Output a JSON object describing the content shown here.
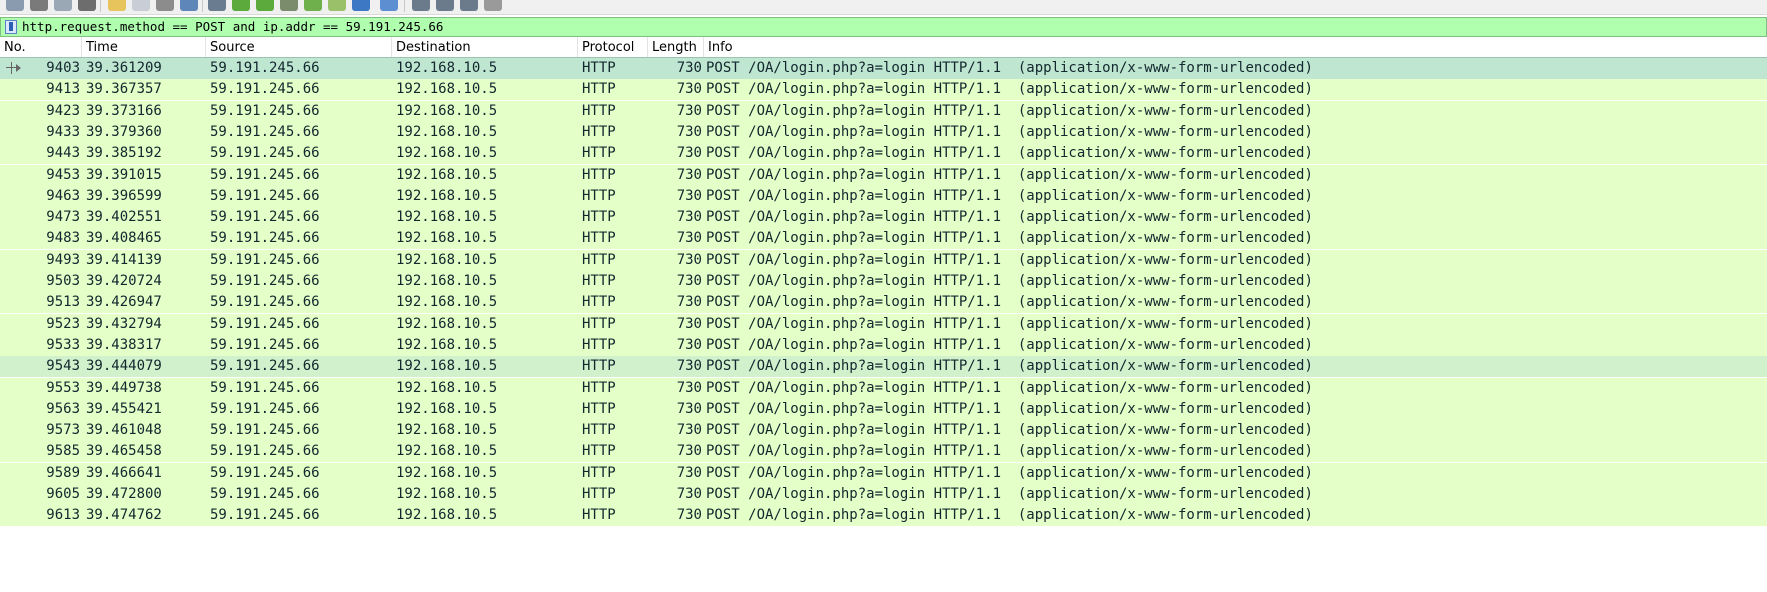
{
  "filter": {
    "expression": "http.request.method == POST and ip.addr == 59.191.245.66"
  },
  "columns": [
    "No.",
    "Time",
    "Source",
    "Destination",
    "Protocol",
    "Length",
    "Info"
  ],
  "packets": [
    {
      "no": "9403",
      "time": "39.361209",
      "src": "59.191.245.66",
      "dst": "192.168.10.5",
      "proto": "HTTP",
      "len": "730",
      "info": "POST /OA/login.php?a=login HTTP/1.1  (application/x-www-form-urlencoded)"
    },
    {
      "no": "9413",
      "time": "39.367357",
      "src": "59.191.245.66",
      "dst": "192.168.10.5",
      "proto": "HTTP",
      "len": "730",
      "info": "POST /OA/login.php?a=login HTTP/1.1  (application/x-www-form-urlencoded)"
    },
    {
      "no": "9423",
      "time": "39.373166",
      "src": "59.191.245.66",
      "dst": "192.168.10.5",
      "proto": "HTTP",
      "len": "730",
      "info": "POST /OA/login.php?a=login HTTP/1.1  (application/x-www-form-urlencoded)"
    },
    {
      "no": "9433",
      "time": "39.379360",
      "src": "59.191.245.66",
      "dst": "192.168.10.5",
      "proto": "HTTP",
      "len": "730",
      "info": "POST /OA/login.php?a=login HTTP/1.1  (application/x-www-form-urlencoded)"
    },
    {
      "no": "9443",
      "time": "39.385192",
      "src": "59.191.245.66",
      "dst": "192.168.10.5",
      "proto": "HTTP",
      "len": "730",
      "info": "POST /OA/login.php?a=login HTTP/1.1  (application/x-www-form-urlencoded)"
    },
    {
      "no": "9453",
      "time": "39.391015",
      "src": "59.191.245.66",
      "dst": "192.168.10.5",
      "proto": "HTTP",
      "len": "730",
      "info": "POST /OA/login.php?a=login HTTP/1.1  (application/x-www-form-urlencoded)"
    },
    {
      "no": "9463",
      "time": "39.396599",
      "src": "59.191.245.66",
      "dst": "192.168.10.5",
      "proto": "HTTP",
      "len": "730",
      "info": "POST /OA/login.php?a=login HTTP/1.1  (application/x-www-form-urlencoded)"
    },
    {
      "no": "9473",
      "time": "39.402551",
      "src": "59.191.245.66",
      "dst": "192.168.10.5",
      "proto": "HTTP",
      "len": "730",
      "info": "POST /OA/login.php?a=login HTTP/1.1  (application/x-www-form-urlencoded)"
    },
    {
      "no": "9483",
      "time": "39.408465",
      "src": "59.191.245.66",
      "dst": "192.168.10.5",
      "proto": "HTTP",
      "len": "730",
      "info": "POST /OA/login.php?a=login HTTP/1.1  (application/x-www-form-urlencoded)"
    },
    {
      "no": "9493",
      "time": "39.414139",
      "src": "59.191.245.66",
      "dst": "192.168.10.5",
      "proto": "HTTP",
      "len": "730",
      "info": "POST /OA/login.php?a=login HTTP/1.1  (application/x-www-form-urlencoded)"
    },
    {
      "no": "9503",
      "time": "39.420724",
      "src": "59.191.245.66",
      "dst": "192.168.10.5",
      "proto": "HTTP",
      "len": "730",
      "info": "POST /OA/login.php?a=login HTTP/1.1  (application/x-www-form-urlencoded)"
    },
    {
      "no": "9513",
      "time": "39.426947",
      "src": "59.191.245.66",
      "dst": "192.168.10.5",
      "proto": "HTTP",
      "len": "730",
      "info": "POST /OA/login.php?a=login HTTP/1.1  (application/x-www-form-urlencoded)"
    },
    {
      "no": "9523",
      "time": "39.432794",
      "src": "59.191.245.66",
      "dst": "192.168.10.5",
      "proto": "HTTP",
      "len": "730",
      "info": "POST /OA/login.php?a=login HTTP/1.1  (application/x-www-form-urlencoded)"
    },
    {
      "no": "9533",
      "time": "39.438317",
      "src": "59.191.245.66",
      "dst": "192.168.10.5",
      "proto": "HTTP",
      "len": "730",
      "info": "POST /OA/login.php?a=login HTTP/1.1  (application/x-www-form-urlencoded)"
    },
    {
      "no": "9543",
      "time": "39.444079",
      "src": "59.191.245.66",
      "dst": "192.168.10.5",
      "proto": "HTTP",
      "len": "730",
      "info": "POST /OA/login.php?a=login HTTP/1.1  (application/x-www-form-urlencoded)"
    },
    {
      "no": "9553",
      "time": "39.449738",
      "src": "59.191.245.66",
      "dst": "192.168.10.5",
      "proto": "HTTP",
      "len": "730",
      "info": "POST /OA/login.php?a=login HTTP/1.1  (application/x-www-form-urlencoded)"
    },
    {
      "no": "9563",
      "time": "39.455421",
      "src": "59.191.245.66",
      "dst": "192.168.10.5",
      "proto": "HTTP",
      "len": "730",
      "info": "POST /OA/login.php?a=login HTTP/1.1  (application/x-www-form-urlencoded)"
    },
    {
      "no": "9573",
      "time": "39.461048",
      "src": "59.191.245.66",
      "dst": "192.168.10.5",
      "proto": "HTTP",
      "len": "730",
      "info": "POST /OA/login.php?a=login HTTP/1.1  (application/x-www-form-urlencoded)"
    },
    {
      "no": "9585",
      "time": "39.465458",
      "src": "59.191.245.66",
      "dst": "192.168.10.5",
      "proto": "HTTP",
      "len": "730",
      "info": "POST /OA/login.php?a=login HTTP/1.1  (application/x-www-form-urlencoded)"
    },
    {
      "no": "9589",
      "time": "39.466641",
      "src": "59.191.245.66",
      "dst": "192.168.10.5",
      "proto": "HTTP",
      "len": "730",
      "info": "POST /OA/login.php?a=login HTTP/1.1  (application/x-www-form-urlencoded)"
    },
    {
      "no": "9605",
      "time": "39.472800",
      "src": "59.191.245.66",
      "dst": "192.168.10.5",
      "proto": "HTTP",
      "len": "730",
      "info": "POST /OA/login.php?a=login HTTP/1.1  (application/x-www-form-urlencoded)"
    },
    {
      "no": "9613",
      "time": "39.474762",
      "src": "59.191.245.66",
      "dst": "192.168.10.5",
      "proto": "HTTP",
      "len": "730",
      "info": "POST /OA/login.php?a=login HTTP/1.1  (application/x-www-form-urlencoded)"
    }
  ],
  "selected_row": 0,
  "hover_row": 14,
  "colors": {
    "filter_valid_bg": "#afffaf",
    "http_row_bg": "#e4ffc7",
    "selected_row_bg": "#bfe6d1",
    "row_text": "#12272e"
  },
  "toolbar_icons": [
    "shark-fin-icon",
    "stop-icon",
    "restart-icon",
    "options-icon",
    "open-file-icon",
    "save-file-icon",
    "close-file-icon",
    "reload-icon",
    "find-packet-icon",
    "go-back-icon",
    "go-forward-icon",
    "go-to-packet-icon",
    "first-packet-icon",
    "last-packet-icon",
    "auto-scroll-icon",
    "colorize-icon",
    "zoom-in-icon",
    "zoom-out-icon",
    "normal-size-icon",
    "resize-columns-icon"
  ]
}
